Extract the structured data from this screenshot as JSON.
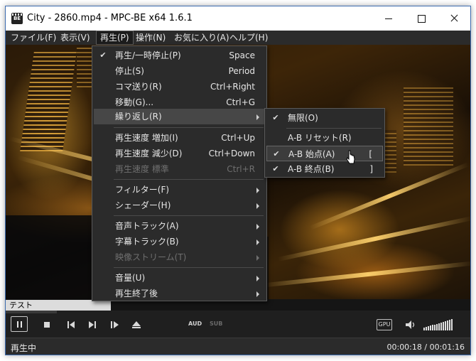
{
  "window": {
    "title": "City - 2860.mp4 - MPC-BE x64 1.6.1",
    "icon_text": "BE"
  },
  "menubar": [
    {
      "label": "ファイル(F)",
      "active": false
    },
    {
      "label": "表示(V)",
      "active": false
    },
    {
      "label": "再生(P)",
      "active": true
    },
    {
      "label": "操作(N)",
      "active": false
    },
    {
      "label": "お気に入り(A)",
      "active": false
    },
    {
      "label": "ヘルプ(H)",
      "active": false
    }
  ],
  "play_menu": {
    "items": [
      {
        "label": "再生/一時停止(P)",
        "shortcut": "Space",
        "checked": true
      },
      {
        "label": "停止(S)",
        "shortcut": "Period"
      },
      {
        "label": "コマ送り(R)",
        "shortcut": "Ctrl+Right"
      },
      {
        "label": "移動(G)...",
        "shortcut": "Ctrl+G"
      },
      {
        "label": "繰り返し(R)",
        "submenu": true,
        "highlighted": true
      },
      {
        "label": "再生速度 増加(I)",
        "shortcut": "Ctrl+Up"
      },
      {
        "label": "再生速度 減少(D)",
        "shortcut": "Ctrl+Down"
      },
      {
        "label": "再生速度 標準",
        "shortcut": "Ctrl+R",
        "disabled": true
      },
      {
        "label": "フィルター(F)",
        "submenu": true
      },
      {
        "label": "シェーダー(H)",
        "submenu": true
      },
      {
        "label": "音声トラック(A)",
        "submenu": true
      },
      {
        "label": "字幕トラック(B)",
        "submenu": true
      },
      {
        "label": "映像ストリーム(T)",
        "submenu": true,
        "disabled": true
      },
      {
        "label": "音量(U)",
        "submenu": true
      },
      {
        "label": "再生終了後",
        "submenu": true
      }
    ]
  },
  "repeat_submenu": {
    "items": [
      {
        "label": "無限(O)",
        "checked": true
      },
      {
        "label": "A-B リセット(R)"
      },
      {
        "label": "A-B 始点(A)",
        "shortcut": "[",
        "checked": true,
        "highlighted": true
      },
      {
        "label": "A-B 終点(B)",
        "shortcut": "]",
        "checked": true
      }
    ]
  },
  "seek": {
    "tooltip": "テスト",
    "progress": 0.11
  },
  "controls": {
    "pause_icon": "pause-icon",
    "stop_icon": "stop-icon",
    "prev_icon": "skip-previous-icon",
    "next_icon": "skip-next-icon",
    "frame_step_icon": "frame-step-icon",
    "eject_icon": "eject-icon",
    "aud_label": "AUD",
    "sub_label": "SUB",
    "gpu_label": "GPU",
    "speaker_icon": "speaker-icon",
    "volume": 1.0
  },
  "status": {
    "state": "再生中",
    "time": "00:00:18 / 00:01:16"
  },
  "colors": {
    "menu_bg": "#2b2b2b",
    "menu_highlight": "#474747",
    "text": "#e6e6e6",
    "disabled_text": "#6f6f6f"
  }
}
